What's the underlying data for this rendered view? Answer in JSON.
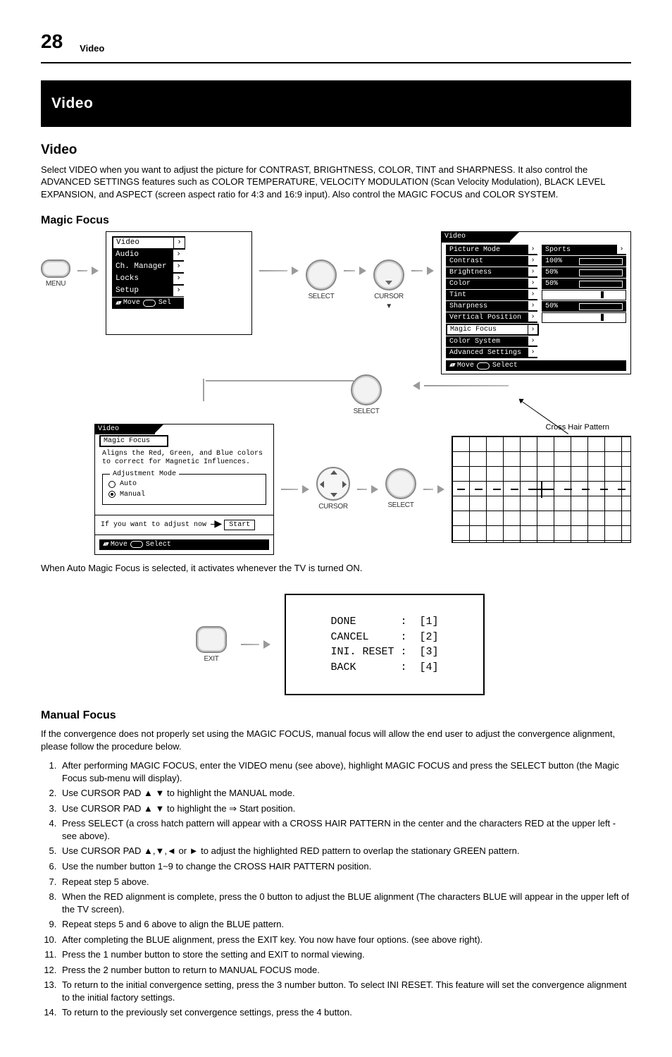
{
  "page_no": "28",
  "header_title": "Video",
  "section_bar": "Video",
  "subheads": {
    "h1": "Video",
    "h2_magic_focus": "Magic Focus",
    "h3_manual_focus": "Manual Focus"
  },
  "paras": {
    "intro": "Select VIDEO when you want to adjust the picture for CONTRAST, BRIGHTNESS, COLOR, TINT and SHARPNESS. It also control the ADVANCED SETTINGS features such as COLOR TEMPERATURE, VELOCITY MODULATION (Scan Velocity Modulation), BLACK LEVEL EXPANSION, and ASPECT (screen aspect ratio for 4:3 and 16:9 input). Also control the MAGIC FOCUS and COLOR SYSTEM.",
    "auto_hint": "When Auto Magic Focus is selected, it activates whenever the TV is turned ON.",
    "manual_intro": "If the convergence does not properly set using the MAGIC FOCUS, manual focus will allow the end user to adjust the convergence alignment, please follow the procedure below."
  },
  "main_menu": {
    "items": [
      "Video",
      "Audio",
      "Ch. Manager",
      "Locks",
      "Setup"
    ],
    "helpbar": {
      "move": "Move",
      "select": "Sel"
    }
  },
  "video_menu": {
    "tab": "Video",
    "rows": [
      {
        "label": "Picture Mode",
        "value": "Sports",
        "type": "chevron"
      },
      {
        "label": "Contrast",
        "value": "100%",
        "type": "bar",
        "fill": 100
      },
      {
        "label": "Brightness",
        "value": "50%",
        "type": "bar",
        "fill": 50
      },
      {
        "label": "Color",
        "value": "50%",
        "type": "bar",
        "fill": 50
      },
      {
        "label": "Tint",
        "value": "",
        "type": "tick",
        "pos": 70
      },
      {
        "label": "Sharpness",
        "value": "50%",
        "type": "bar",
        "fill": 50
      },
      {
        "label": "Vertical Position",
        "value": "",
        "type": "tick",
        "pos": 70
      },
      {
        "label": "Magic Focus",
        "value": "",
        "type": "none",
        "highlight": true
      },
      {
        "label": "Color System",
        "value": "",
        "type": "none"
      },
      {
        "label": "Advanced Settings",
        "value": "",
        "type": "none"
      }
    ],
    "helpbar": {
      "move": "Move",
      "select": "Select"
    }
  },
  "mf_card": {
    "tab_top": "Video",
    "tab_sub": "Magic Focus",
    "desc": "Aligns the Red, Green, and Blue colors to correct for Magnetic Influences.",
    "group_legend": "Adjustment Mode",
    "options": [
      {
        "label": "Auto",
        "checked": false
      },
      {
        "label": "Manual",
        "checked": true
      }
    ],
    "start_row_text": "If you want to adjust now",
    "start_button": "Start",
    "helpbar": {
      "move": "Move",
      "select": "Select"
    }
  },
  "buttons": {
    "menu": "MENU",
    "select": "SELECT",
    "cursor_down": "CURSOR ▼",
    "cursor_pad": "CURSOR",
    "exit": "EXIT"
  },
  "crosshatch_callout": "Cross Hair Pattern",
  "final_menu": {
    "lines": [
      "DONE       :  [1]",
      "CANCEL     :  [2]",
      "INI. RESET :  [3]",
      "BACK       :  [4]"
    ]
  },
  "steps": [
    "After performing MAGIC FOCUS, enter the VIDEO menu (see above), highlight MAGIC FOCUS and press the SELECT button (the Magic Focus sub-menu will display).",
    "Use CURSOR PAD ▲ ▼ to highlight the MANUAL mode.",
    "Use CURSOR PAD ▲ ▼ to highlight the ⇒ Start position.",
    "Press SELECT (a cross hatch pattern will appear with a CROSS HAIR PATTERN in the center and the characters RED at the upper left - see above).",
    "Use CURSOR PAD ▲,▼,◄ or ► to adjust the highlighted RED pattern to overlap the stationary GREEN pattern.",
    "Use the number button 1~9 to change the CROSS HAIR PATTERN position.",
    "Repeat step 5 above.",
    "When the RED alignment is complete, press the 0 button to adjust the BLUE alignment (The characters BLUE will appear in the upper left of the TV screen).",
    "Repeat steps 5 and 6 above to align the BLUE pattern.",
    "After completing the BLUE alignment, press the EXIT key. You now have four options. (see above right).",
    "Press the 1 number button to store the setting and EXIT to normal viewing.",
    "Press the 2 number button to return to MANUAL FOCUS mode.",
    "To return to the initial convergence setting, press the 3 number button. To select INI RESET. This feature will set the convergence alignment to the initial factory settings.",
    "To return to the previously set convergence settings, press the 4 button."
  ]
}
